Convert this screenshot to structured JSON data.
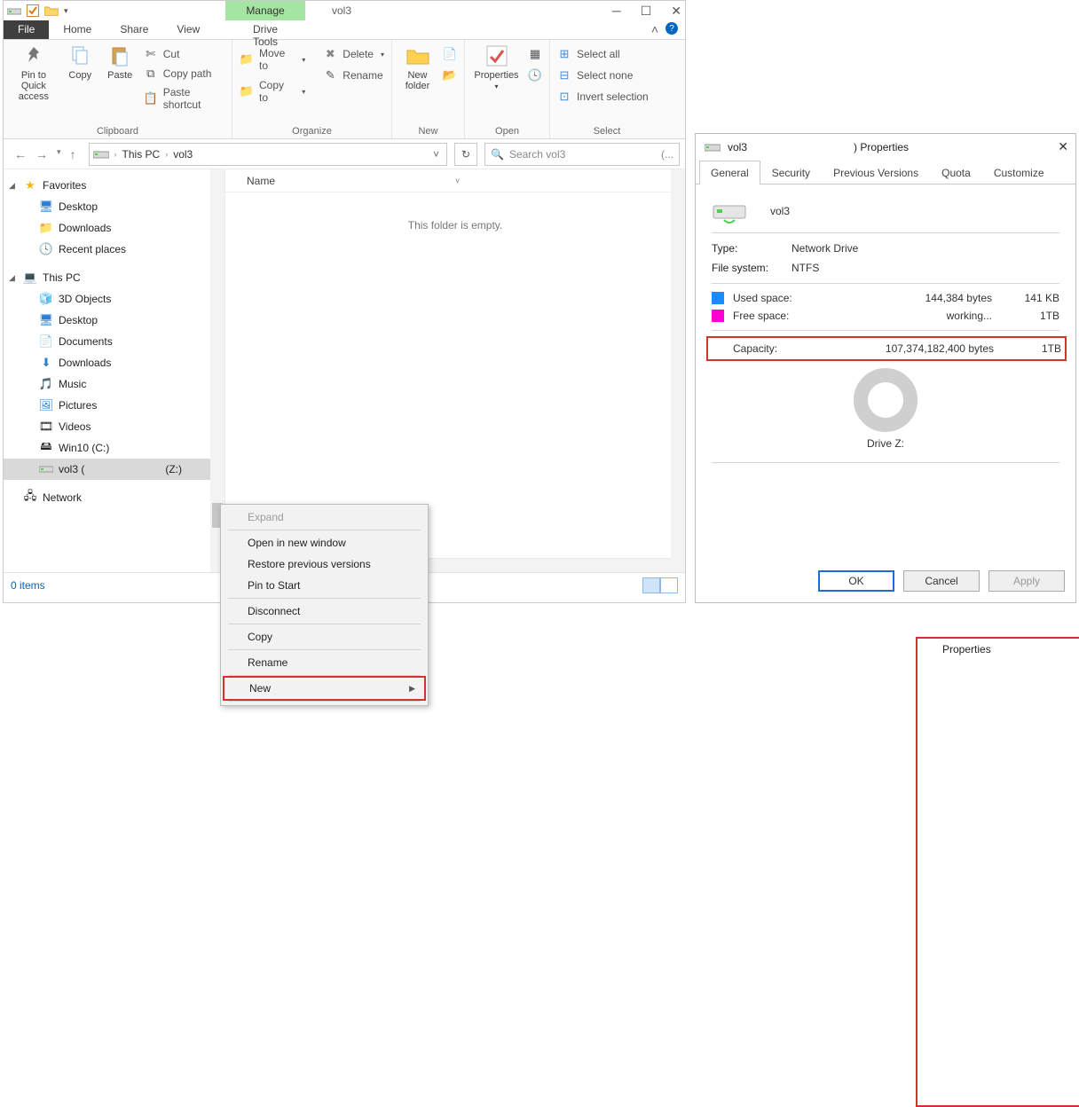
{
  "title": {
    "manage": "Manage",
    "volume": "vol3"
  },
  "tabs": {
    "file": "File",
    "home": "Home",
    "share": "Share",
    "view": "View",
    "drive": "Drive Tools"
  },
  "ribbon": {
    "clipboard": {
      "pin": "Pin to Quick access",
      "copy": "Copy",
      "paste": "Paste",
      "cut": "Cut",
      "copypath": "Copy path",
      "pastesc": "Paste shortcut",
      "label": "Clipboard"
    },
    "organize": {
      "moveto": "Move to",
      "copyto": "Copy to",
      "delete": "Delete",
      "rename": "Rename",
      "label": "Organize"
    },
    "new": {
      "newfolder": "New folder",
      "label": "New"
    },
    "open": {
      "properties": "Properties",
      "label": "Open"
    },
    "select": {
      "all": "Select all",
      "none": "Select none",
      "invert": "Invert selection",
      "label": "Select"
    }
  },
  "breadcrumb": {
    "pc": "This PC",
    "vol": "vol3"
  },
  "search": {
    "placeholder": "Search vol3"
  },
  "tree": {
    "favorites": "Favorites",
    "desktop": "Desktop",
    "downloads": "Downloads",
    "recent": "Recent places",
    "thispc": "This PC",
    "objects3d": "3D Objects",
    "desktop2": "Desktop",
    "documents": "Documents",
    "downloads2": "Downloads",
    "music": "Music",
    "pictures": "Pictures",
    "videos": "Videos",
    "cdrive": "Win10 (C:)",
    "vol3": "vol3 (",
    "vol3_suffix": "(Z:)",
    "network": "Network"
  },
  "content": {
    "name_hdr": "Name",
    "empty": "This folder is empty."
  },
  "status": {
    "items": "0 items"
  },
  "ctx": {
    "expand": "Expand",
    "openwin": "Open in new window",
    "restore": "Restore previous versions",
    "pin": "Pin to Start",
    "disconnect": "Disconnect",
    "copy": "Copy",
    "rename": "Rename",
    "new": "New",
    "properties": "Properties"
  },
  "props": {
    "title_prefix": "vol3",
    "title_suffix": ") Properties",
    "tabs": {
      "general": "General",
      "security": "Security",
      "prev": "Previous Versions",
      "quota": "Quota",
      "customize": "Customize"
    },
    "name": "vol3",
    "type_lbl": "Type:",
    "type_val": "Network Drive",
    "fs_lbl": "File system:",
    "fs_val": "NTFS",
    "used_lbl": "Used space:",
    "used_bytes": "144,384 bytes",
    "used_h": "141 KB",
    "free_lbl": "Free space:",
    "free_bytes": "working...",
    "free_h": "1TB",
    "cap_lbl": "Capacity:",
    "cap_bytes": "107,374,182,400 bytes",
    "cap_h": "1TB",
    "drive": "Drive Z:",
    "ok": "OK",
    "cancel": "Cancel",
    "apply": "Apply"
  }
}
